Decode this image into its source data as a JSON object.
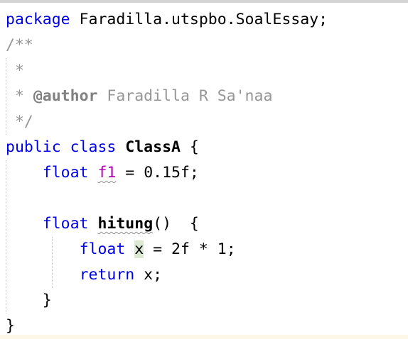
{
  "code": {
    "line1": {
      "kw": "package",
      "rest": " Faradilla.utspbo.SoalEssay;"
    },
    "line2": {
      "text": "/**"
    },
    "line3": {
      "text": " *"
    },
    "line4": {
      "prefix": " * ",
      "tag": "@author",
      "rest": " Faradilla R Sa'naa"
    },
    "line5": {
      "text": " */"
    },
    "line6": {
      "kw": "public class",
      "space": " ",
      "name": "ClassA",
      "rest": " {"
    },
    "line7": {
      "indent": "    ",
      "type": "float",
      "space": " ",
      "field": "f1",
      "rest": " = 0.15f;"
    },
    "line8": {
      "text": ""
    },
    "line9": {
      "indent": "    ",
      "type": "float",
      "space": " ",
      "method": "hitung",
      "rest": "()  {"
    },
    "line10": {
      "indent": "        ",
      "type": "float",
      "space": " ",
      "var": "x",
      "rest": " = 2f * 1;"
    },
    "line11": {
      "indent": "        ",
      "kw": "return",
      "rest": " x;"
    },
    "line12": {
      "text": "    }"
    },
    "line13": {
      "text": "}"
    }
  },
  "colors": {
    "keyword": "#0000e6",
    "comment": "#969696",
    "field": "#b200b2",
    "highlight": "#dbe9d3"
  }
}
